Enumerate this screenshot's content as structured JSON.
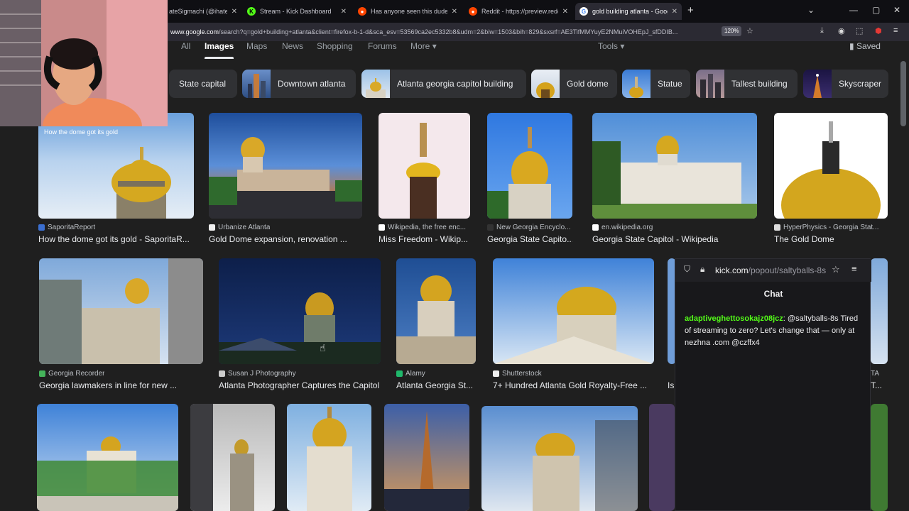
{
  "browser": {
    "tabs": [
      {
        "title": "ateSigmachi (@ihatesign",
        "favicon": "x-logo",
        "color": "#000000"
      },
      {
        "title": "Stream - Kick Dashboard",
        "favicon": "kick-logo",
        "color": "#53fc18"
      },
      {
        "title": "Has anyone seen this dude on ...",
        "favicon": "reddit-logo",
        "color": "#ff4500"
      },
      {
        "title": "Reddit - https://preview.redd.it/...",
        "favicon": "reddit-logo",
        "color": "#ff4500"
      },
      {
        "title": "gold building atlanta - Google S",
        "favicon": "google-logo",
        "color": "#4285f4",
        "active": true
      }
    ],
    "url_host": "www.google.com",
    "url_rest": "/search?q=gold+building+atlanta&client=firefox-b-1-d&sca_esv=53569ca2ec5332b8&udm=2&biw=1503&bih=829&sxsrf=AE3TifMMYuyE2NMuiVOHEpJ_sfDDIB...",
    "zoom": "120%"
  },
  "google": {
    "tabs": [
      {
        "label": "All"
      },
      {
        "label": "Images",
        "active": true
      },
      {
        "label": "Maps"
      },
      {
        "label": "News"
      },
      {
        "label": "Shopping"
      },
      {
        "label": "Forums"
      },
      {
        "label": "More"
      }
    ],
    "tools_label": "Tools",
    "saved_label": "Saved",
    "chips": [
      {
        "label": "State capital"
      },
      {
        "label": "Downtown atlanta"
      },
      {
        "label": "Atlanta georgia capitol building"
      },
      {
        "label": "Gold dome"
      },
      {
        "label": "Statue"
      },
      {
        "label": "Tallest building"
      },
      {
        "label": "Skyscraper"
      }
    ],
    "results": [
      {
        "source": "SaporitaReport",
        "caption": "How the dome got its gold - SaporitaR...",
        "overlay": "How the dome got its gold"
      },
      {
        "source": "Urbanize Atlanta",
        "caption": "Gold Dome expansion, renovation ..."
      },
      {
        "source": "Wikipedia, the free enc...",
        "caption": "Miss Freedom - Wikip..."
      },
      {
        "source": "New Georgia Encyclo...",
        "caption": "Georgia State Capito..."
      },
      {
        "source": "en.wikipedia.org",
        "caption": "Georgia State Capitol - Wikipedia"
      },
      {
        "source": "HyperPhysics - Georgia Stat...",
        "caption": "The Gold Dome"
      },
      {
        "source": "Georgia Recorder",
        "caption": "Georgia lawmakers in line for new ..."
      },
      {
        "source": "Susan J Photography",
        "caption": "Atlanta Photographer Captures the Capitol"
      },
      {
        "source": "Alamy",
        "caption": "Atlanta Georgia St..."
      },
      {
        "source": "Shutterstock",
        "caption": "7+ Hundred Atlanta Gold Royalty-Free ..."
      },
      {
        "source": "TA",
        "caption": "Is"
      },
      {
        "source": "",
        "caption": "T..."
      }
    ]
  },
  "chat": {
    "url_main": "kick.com",
    "url_rest": "/popout/saltyballs-8s",
    "title": "Chat",
    "message": {
      "user": "adaptiveghettosokajz08jcz",
      "separator": ": ",
      "text": "@saltyballs-8s Tired of streaming to zero? Let's change that — only at nezhna .com @czffx4"
    }
  },
  "colors": {
    "background": "#1f1f1f",
    "kick_green": "#53fc18",
    "chip_bg": "#303134"
  }
}
